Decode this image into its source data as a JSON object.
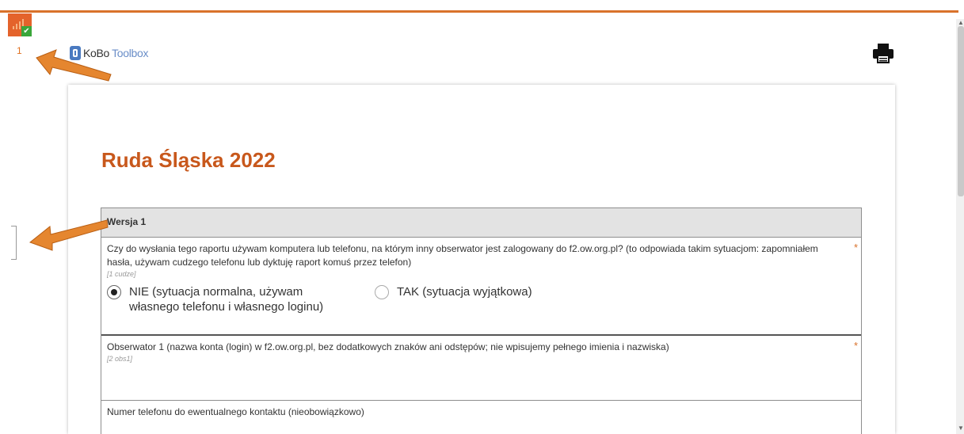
{
  "app": {
    "offline_counter": "1",
    "logo_text_primary": "KoBo",
    "logo_text_secondary": "Toolbox",
    "accent_color": "#d9722b",
    "title_color": "#c8581c"
  },
  "icons": {
    "offline_status": "signal-bars-icon",
    "submitted_check": "check-icon",
    "print": "print-icon"
  },
  "form": {
    "title": "Ruda Śląska 2022",
    "group": {
      "label": "Wersja 1",
      "questions": [
        {
          "label": "Czy do wysłania tego raportu używam komputera lub telefonu, na którym inny obserwator jest zalogowany do f2.ow.org.pl? (to odpowiada takim sytuacjom: zapomniałem hasła, używam cudzego telefonu lub dyktuję raport komuś przez telefon)",
          "hint": "[1 cudze]",
          "required_mark": "*",
          "options": [
            {
              "label": "NIE (sytuacja normalna, używam własnego telefonu i własnego loginu)",
              "selected": true
            },
            {
              "label": "TAK (sytuacja wyjątkowa)",
              "selected": false
            }
          ]
        },
        {
          "label": "Obserwator 1 (nazwa konta (login) w f2.ow.org.pl, bez dodatkowych znaków ani odstępów; nie wpisujemy pełnego imienia i nazwiska)",
          "hint": "[2 obs1]",
          "required_mark": "*",
          "value": ""
        },
        {
          "label": "Numer telefonu do ewentualnego kontaktu (nieobowiązkowo)"
        }
      ]
    }
  }
}
